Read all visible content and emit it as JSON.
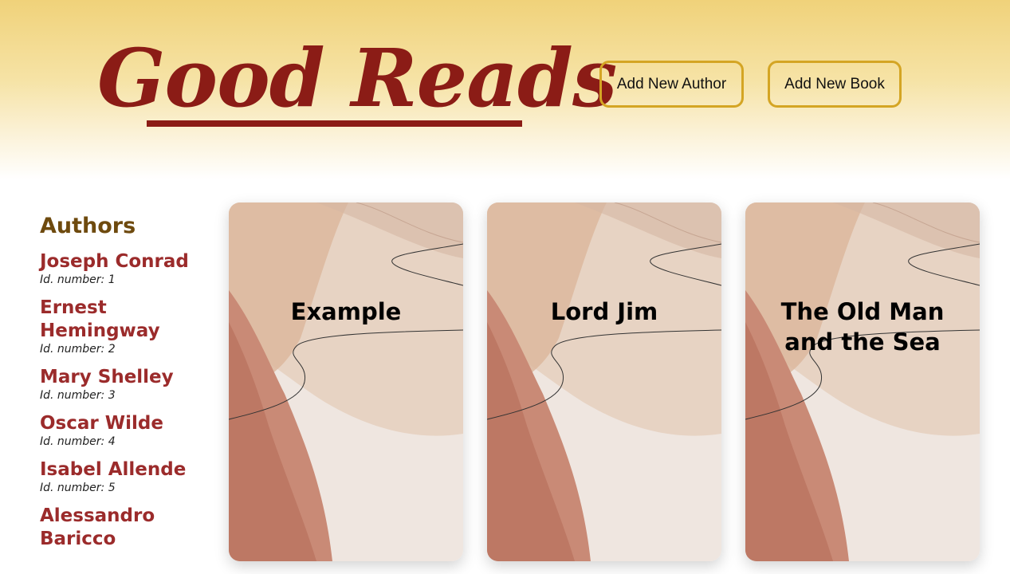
{
  "header": {
    "logo": "Good Reads",
    "buttons": {
      "add_author": "Add New Author",
      "add_book": "Add New Book"
    }
  },
  "sidebar": {
    "title": "Authors",
    "authors": [
      {
        "name": "Joseph Conrad",
        "id_label": "Id. number: 1"
      },
      {
        "name": "Ernest Hemingway",
        "id_label": "Id. number: 2"
      },
      {
        "name": "Mary Shelley",
        "id_label": "Id. number: 3"
      },
      {
        "name": "Oscar Wilde",
        "id_label": "Id. number: 4"
      },
      {
        "name": "Isabel Allende",
        "id_label": "Id. number: 5"
      },
      {
        "name": "Alessandro Baricco",
        "id_label": ""
      }
    ]
  },
  "books": [
    {
      "title": "Example"
    },
    {
      "title": "Lord Jim"
    },
    {
      "title": "The Old Man and the Sea"
    }
  ],
  "colors": {
    "brand": "#8b1c16",
    "button_border": "#d4a524",
    "author_name": "#9b2b2b",
    "sidebar_title": "#6e4a0e"
  }
}
